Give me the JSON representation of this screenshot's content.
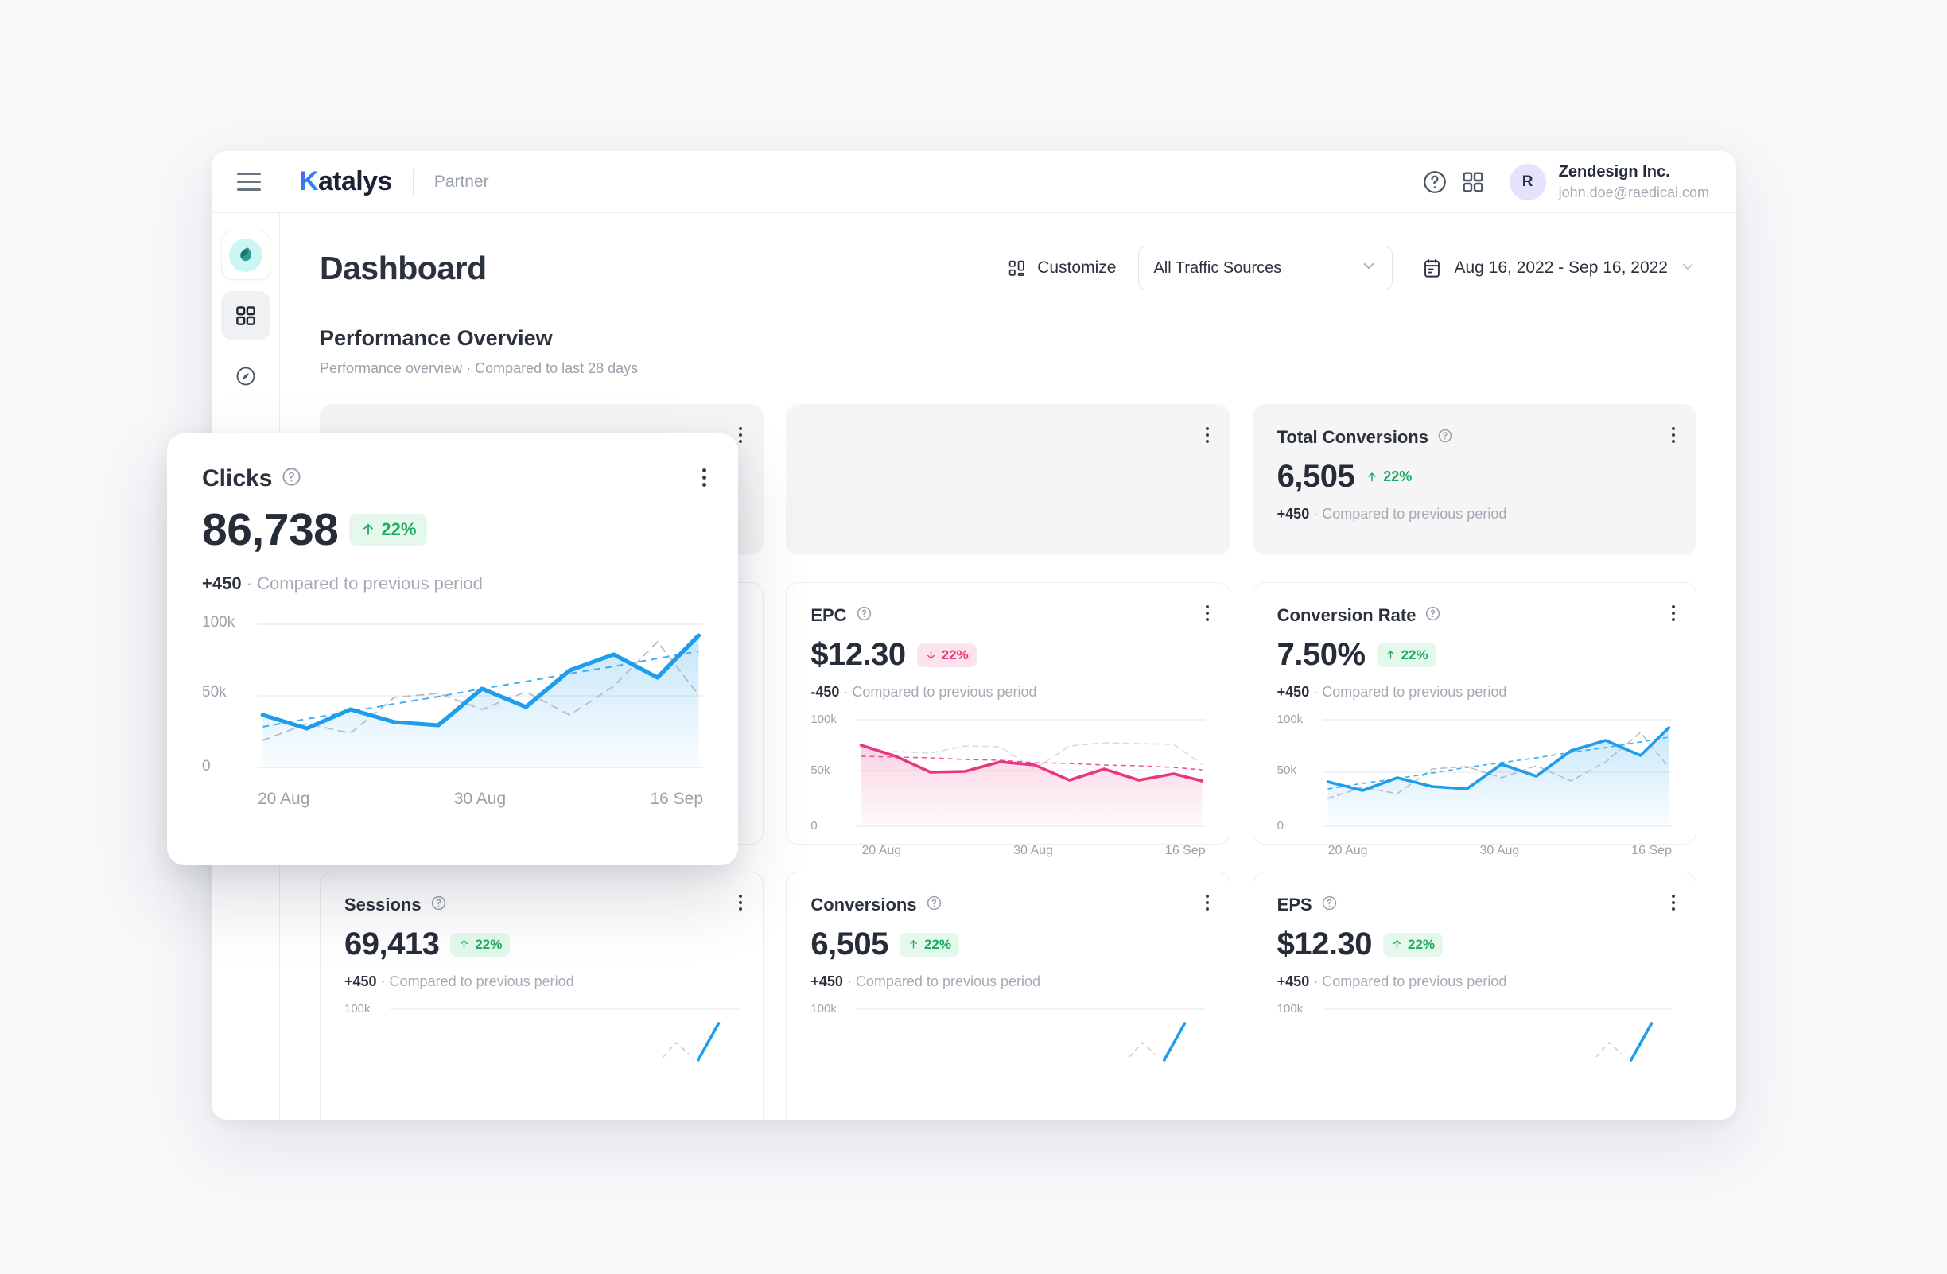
{
  "topbar": {
    "menu_icon": "hamburger-icon",
    "logo_first": "K",
    "logo_rest": "atalys",
    "logo_sub": "Partner",
    "help_icon": "question-circle-icon",
    "apps_icon": "grid-apps-icon",
    "avatar_initial": "R",
    "user_name": "Zendesign Inc.",
    "user_email": "john.doe@raedical.com"
  },
  "sidebar": {
    "items": [
      {
        "name": "brand-logo",
        "icon": "leaf-icon",
        "active": false
      },
      {
        "name": "dashboard",
        "icon": "grid-dashboard-icon",
        "active": true
      },
      {
        "name": "explore",
        "icon": "compass-icon",
        "active": false
      }
    ]
  },
  "page": {
    "title": "Dashboard",
    "customize_label": "Customize",
    "customize_icon": "layout-icon",
    "traffic_select_value": "All Traffic Sources",
    "date_icon": "calendar-icon",
    "date_range": "Aug 16, 2022 - Sep 16, 2022",
    "chevron_icon": "chevron-down-icon",
    "section_title": "Performance Overview",
    "section_sub": "Performance overview · Compared to last 28 days"
  },
  "colors": {
    "blue": "#1f9ded",
    "blue_dash": "#3fb0f2",
    "pink": "#e8367f",
    "green": "#1eab62",
    "green_bg": "#e4f8ec",
    "pink_bg": "#fde3ee",
    "grid": "#e8eaed",
    "muted_card": "#f5f5f6"
  },
  "labels": {
    "delta_positive": "+450",
    "delta_negative": "-450",
    "compare_text": "· Compared to previous period",
    "help_icon": "question-circle-icon",
    "kebab_icon": "more-vertical-icon"
  },
  "cards": {
    "clicks": {
      "title": "Clicks",
      "value": "86,738",
      "change": "22%",
      "direction": "up",
      "delta": "+450",
      "compare": "· Compared to previous period"
    },
    "hidden_card": {
      "title": "",
      "value": ""
    },
    "total_conversions": {
      "title": "Total Conversions",
      "value": "6,505",
      "change": "22%",
      "direction": "up",
      "delta": "+450",
      "compare": "· Compared to previous period"
    },
    "epc": {
      "title": "EPC",
      "value": "$12.30",
      "change": "22%",
      "direction": "down",
      "delta": "-450",
      "compare": "· Compared to previous period"
    },
    "conversion_rate": {
      "title": "Conversion Rate",
      "value": "7.50%",
      "change": "22%",
      "direction": "up",
      "delta": "+450",
      "compare": "· Compared to previous period"
    },
    "sessions": {
      "title": "Sessions",
      "value": "69,413",
      "change": "22%",
      "direction": "up",
      "delta": "+450",
      "compare": "· Compared to previous period"
    },
    "conversions": {
      "title": "Conversions",
      "value": "6,505",
      "change": "22%",
      "direction": "up",
      "delta": "+450",
      "compare": "· Compared to previous period"
    },
    "eps": {
      "title": "EPS",
      "value": "$12.30",
      "change": "22%",
      "direction": "up",
      "delta": "+450",
      "compare": "· Compared to previous period"
    }
  },
  "chart_data": [
    {
      "id": "clicks",
      "type": "line",
      "title": "Clicks",
      "ylabel": "",
      "xlabel": "",
      "ylim": [
        0,
        100000
      ],
      "yticks": [
        0,
        50000,
        100000
      ],
      "ytick_labels": [
        "0",
        "50k",
        "100k"
      ],
      "xtick_labels": [
        "20 Aug",
        "30 Aug",
        "16 Sep"
      ],
      "grid": true,
      "legend": "none",
      "series": [
        {
          "name": "Clicks (current)",
          "style": "solid-area",
          "color": "#1f9ded",
          "values": [
            42000,
            33000,
            45000,
            37000,
            35000,
            58000,
            46000,
            70000,
            80000,
            66000,
            92000
          ]
        },
        {
          "name": "Previous period",
          "style": "dashed",
          "color": "#b8bdc4",
          "values": [
            26000,
            36000,
            31000,
            52000,
            54000,
            44000,
            56000,
            42000,
            60000,
            87000,
            57000
          ]
        },
        {
          "name": "Trend",
          "style": "dashed",
          "color": "#3fb0f2",
          "values": [
            34000,
            39000,
            44000,
            49000,
            54000,
            59000,
            63000,
            68000,
            73000,
            78000,
            83000
          ]
        }
      ]
    },
    {
      "id": "epc",
      "type": "line",
      "title": "EPC",
      "ylim": [
        0,
        100000
      ],
      "yticks": [
        0,
        50000,
        100000
      ],
      "ytick_labels": [
        "0",
        "50k",
        "100k"
      ],
      "xtick_labels": [
        "20 Aug",
        "30 Aug",
        "16 Sep"
      ],
      "grid": true,
      "legend": "none",
      "series": [
        {
          "name": "EPC (current)",
          "style": "solid-area",
          "color": "#e8367f",
          "values": [
            76000,
            66000,
            53000,
            54000,
            63000,
            60000,
            47000,
            58000,
            47000,
            53000,
            46000
          ]
        },
        {
          "name": "Previous period",
          "style": "dashed",
          "color": "#d9dbdf",
          "values": [
            62000,
            68000,
            66000,
            75000,
            74000,
            53000,
            75000,
            78000,
            77000,
            76000,
            58000
          ]
        },
        {
          "name": "Trend",
          "style": "dashed",
          "color": "#e8367f",
          "values": [
            62000,
            61000,
            60000,
            59000,
            58000,
            56000,
            55000,
            54000,
            53000,
            52000,
            50000
          ]
        }
      ]
    },
    {
      "id": "conversion_rate",
      "type": "line",
      "title": "Conversion Rate",
      "ylim": [
        0,
        100000
      ],
      "yticks": [
        0,
        50000,
        100000
      ],
      "ytick_labels": [
        "0",
        "50k",
        "100k"
      ],
      "xtick_labels": [
        "20 Aug",
        "30 Aug",
        "16 Sep"
      ],
      "grid": true,
      "legend": "none",
      "series": [
        {
          "name": "Conversion Rate (current)",
          "style": "solid-area",
          "color": "#1f9ded",
          "values": [
            42000,
            33000,
            45000,
            37000,
            35000,
            58000,
            46000,
            70000,
            80000,
            66000,
            92000
          ]
        },
        {
          "name": "Previous period",
          "style": "dashed",
          "color": "#b8bdc4",
          "values": [
            26000,
            36000,
            31000,
            52000,
            54000,
            44000,
            56000,
            42000,
            60000,
            87000,
            57000
          ]
        },
        {
          "name": "Trend",
          "style": "dashed",
          "color": "#3fb0f2",
          "values": [
            34000,
            39000,
            44000,
            49000,
            54000,
            59000,
            63000,
            68000,
            73000,
            78000,
            83000
          ]
        }
      ]
    },
    {
      "id": "sessions",
      "type": "line",
      "title": "Sessions",
      "ylim": [
        0,
        100000
      ],
      "yticks": [
        100000
      ],
      "ytick_labels": [
        "100k"
      ],
      "xtick_labels": [],
      "grid": true,
      "legend": "none",
      "clipped": true,
      "series": [
        {
          "name": "Sessions (current)",
          "style": "solid-area",
          "color": "#1f9ded",
          "values": []
        }
      ]
    },
    {
      "id": "conversions",
      "type": "line",
      "title": "Conversions",
      "ylim": [
        0,
        100000
      ],
      "yticks": [
        100000
      ],
      "ytick_labels": [
        "100k"
      ],
      "xtick_labels": [],
      "grid": true,
      "legend": "none",
      "clipped": true,
      "series": [
        {
          "name": "Conversions (current)",
          "style": "solid-area",
          "color": "#1f9ded",
          "values": []
        }
      ]
    },
    {
      "id": "eps",
      "type": "line",
      "title": "EPS",
      "ylim": [
        0,
        100000
      ],
      "yticks": [
        100000
      ],
      "ytick_labels": [
        "100k"
      ],
      "xtick_labels": [],
      "grid": true,
      "legend": "none",
      "clipped": true,
      "series": [
        {
          "name": "EPS (current)",
          "style": "solid-area",
          "color": "#1f9ded",
          "values": []
        }
      ]
    }
  ]
}
